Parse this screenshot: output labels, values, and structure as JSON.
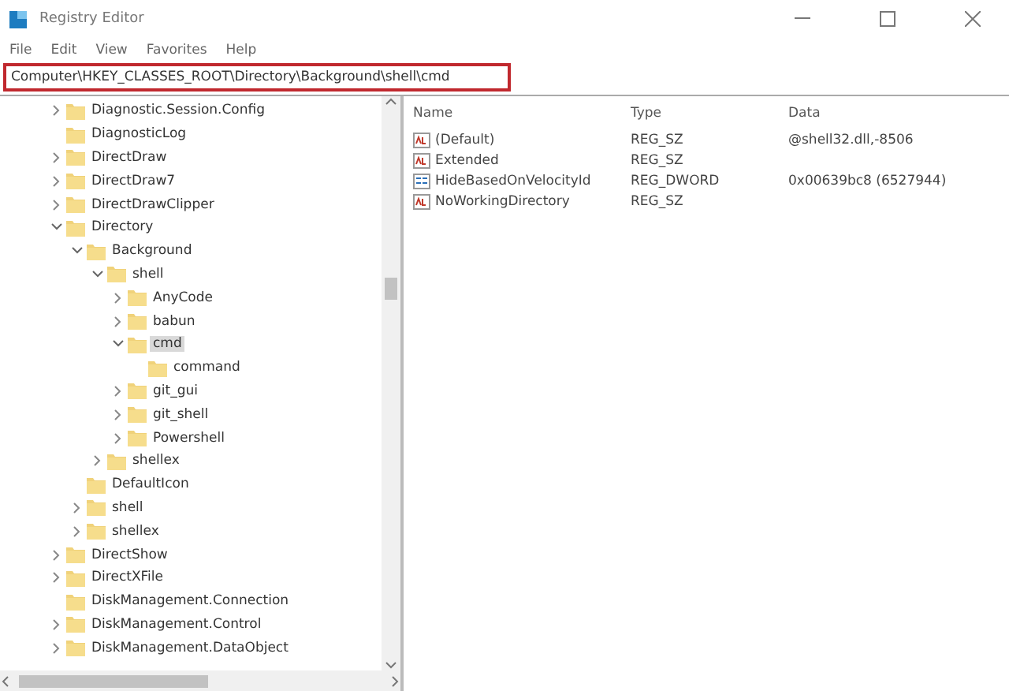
{
  "window": {
    "title": "Registry Editor"
  },
  "menu": [
    "File",
    "Edit",
    "View",
    "Favorites",
    "Help"
  ],
  "address": {
    "value": "Computer\\HKEY_CLASSES_ROOT\\Directory\\Background\\shell\\cmd",
    "highlighted": true
  },
  "tree": [
    {
      "label": "Diagnostic.Session.Config",
      "expanded": false,
      "selected": false
    },
    {
      "label": "DiagnosticLog",
      "selected": false
    },
    {
      "label": "DirectDraw",
      "expanded": false,
      "selected": false
    },
    {
      "label": "DirectDraw7",
      "expanded": false,
      "selected": false
    },
    {
      "label": "DirectDrawClipper",
      "expanded": false,
      "selected": false
    },
    {
      "label": "Directory",
      "expanded": true,
      "selected": false,
      "children": [
        {
          "label": "Background",
          "expanded": true,
          "selected": false,
          "children": [
            {
              "label": "shell",
              "expanded": true,
              "selected": false,
              "children": [
                {
                  "label": "AnyCode",
                  "expanded": false,
                  "selected": false
                },
                {
                  "label": "babun",
                  "expanded": false,
                  "selected": false
                },
                {
                  "label": "cmd",
                  "expanded": true,
                  "selected": true,
                  "children": [
                    {
                      "label": "command",
                      "selected": false
                    }
                  ]
                },
                {
                  "label": "git_gui",
                  "expanded": false,
                  "selected": false
                },
                {
                  "label": "git_shell",
                  "expanded": false,
                  "selected": false
                },
                {
                  "label": "Powershell",
                  "expanded": false,
                  "selected": false
                }
              ]
            },
            {
              "label": "shellex",
              "expanded": false,
              "selected": false
            }
          ]
        },
        {
          "label": "DefaultIcon",
          "selected": false
        },
        {
          "label": "shell",
          "expanded": false,
          "selected": false
        },
        {
          "label": "shellex",
          "expanded": false,
          "selected": false
        }
      ]
    },
    {
      "label": "DirectShow",
      "expanded": false,
      "selected": false
    },
    {
      "label": "DirectXFile",
      "expanded": false,
      "selected": false
    },
    {
      "label": "DiskManagement.Connection",
      "selected": false
    },
    {
      "label": "DiskManagement.Control",
      "expanded": false,
      "selected": false
    },
    {
      "label": "DiskManagement.DataObject",
      "expanded": false,
      "selected": false
    }
  ],
  "values": {
    "columns": [
      "Name",
      "Type",
      "Data"
    ],
    "rows": [
      {
        "kind": "string",
        "name": "(Default)",
        "type": "REG_SZ",
        "data": "@shell32.dll,-8506"
      },
      {
        "kind": "string",
        "name": "Extended",
        "type": "REG_SZ"
      },
      {
        "kind": "binary",
        "name": "HideBasedOnVelocityId",
        "type": "REG_DWORD",
        "data": "0x00639bc8 (6527944)"
      },
      {
        "kind": "string",
        "name": "NoWorkingDirectory",
        "type": "REG_SZ"
      }
    ]
  }
}
